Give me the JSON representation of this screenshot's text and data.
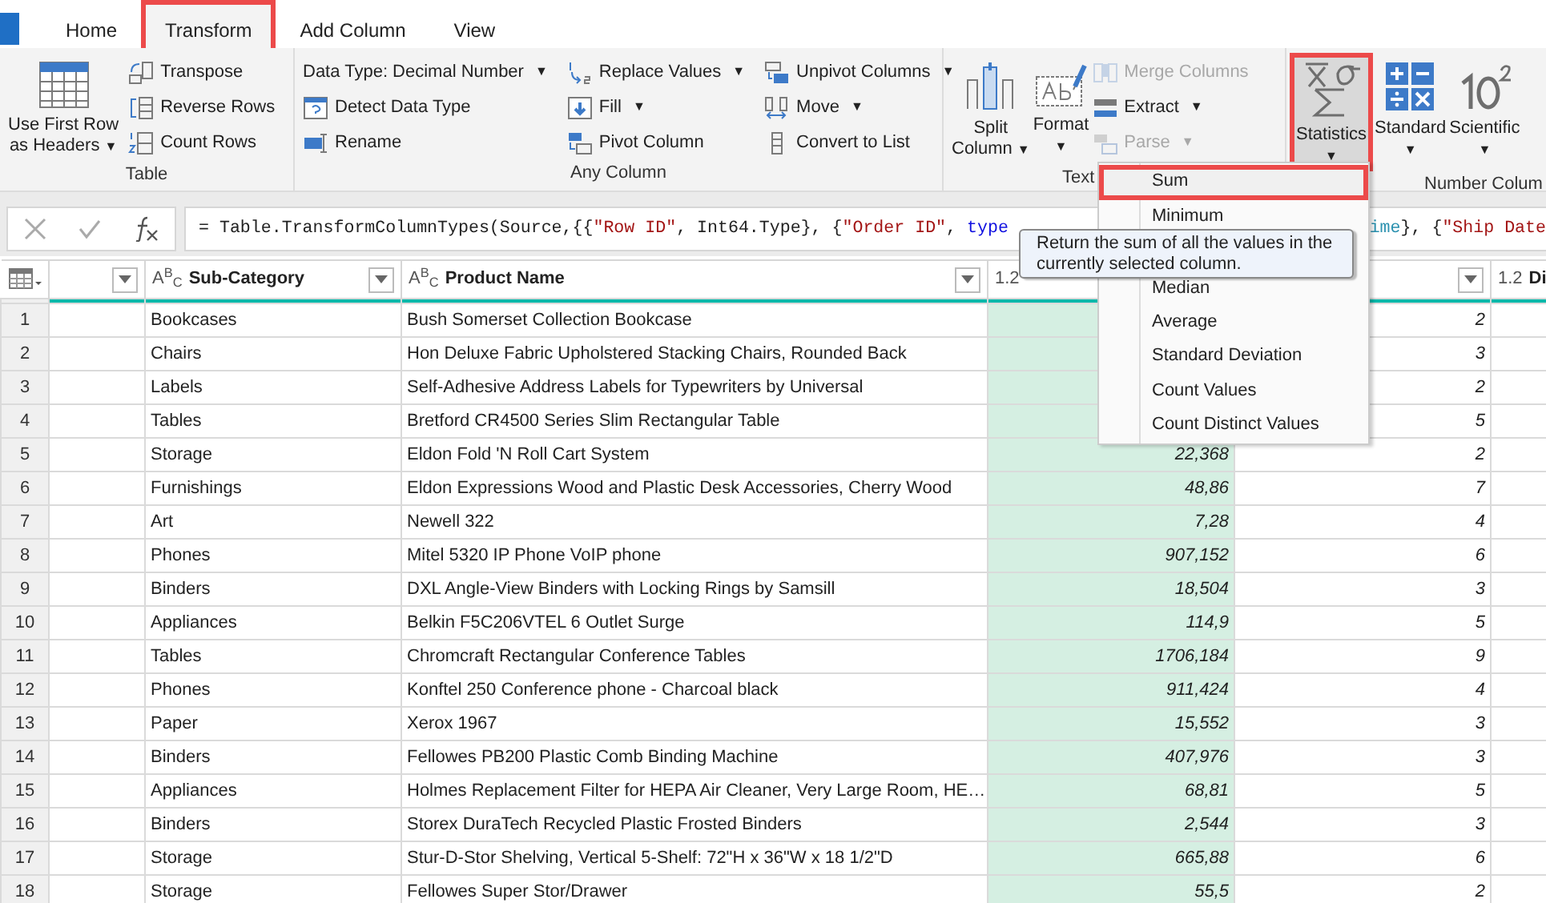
{
  "tabs": [
    {
      "label": "Home",
      "selected": false,
      "annotated": false
    },
    {
      "label": "Transform",
      "selected": true,
      "annotated": true
    },
    {
      "label": "Add Column",
      "selected": false,
      "annotated": false
    },
    {
      "label": "View",
      "selected": false,
      "annotated": false
    }
  ],
  "ribbon": {
    "groups": [
      {
        "label": "Table",
        "items": [
          {
            "kind": "large",
            "lines": [
              "Use First Row",
              "as Headers"
            ],
            "caret": "▼",
            "caret_below": false,
            "pressed": false,
            "annotated": false
          },
          {
            "kind": "stack",
            "items": [
              {
                "label": "Transpose",
                "disabled": false
              },
              {
                "label": "Reverse Rows",
                "disabled": false
              },
              {
                "label": "Count Rows",
                "disabled": false
              }
            ]
          }
        ]
      },
      {
        "label": "Any Column",
        "items": [
          {
            "kind": "stack",
            "items": [
              {
                "label": "Data Type: Decimal Number",
                "caret": "▼",
                "disabled": false
              },
              {
                "label": "Detect Data Type",
                "disabled": false
              },
              {
                "label": "Rename",
                "disabled": false
              }
            ]
          },
          {
            "kind": "stack",
            "items": [
              {
                "label": "Replace Values",
                "caret": "▼",
                "disabled": false
              },
              {
                "label": "Fill",
                "caret": "▼",
                "disabled": false
              },
              {
                "label": "Pivot Column",
                "disabled": false
              }
            ]
          },
          {
            "kind": "stack",
            "items": [
              {
                "label": "Unpivot Columns",
                "caret": "▼",
                "disabled": false
              },
              {
                "label": "Move",
                "caret": "▼",
                "disabled": false
              },
              {
                "label": "Convert to List",
                "disabled": false
              }
            ]
          }
        ]
      },
      {
        "label": "Text",
        "items": [
          {
            "kind": "large",
            "lines": [
              "Split",
              "Column"
            ],
            "caret": "▼",
            "caret_below": false,
            "pressed": false,
            "annotated": false
          },
          {
            "kind": "large",
            "lines": [
              "Format"
            ],
            "caret": "▼",
            "caret_below": true,
            "pressed": false,
            "annotated": false
          },
          {
            "kind": "stack",
            "items": [
              {
                "label": "Merge Columns",
                "disabled": true
              },
              {
                "label": "Extract",
                "caret": "▼",
                "disabled": false
              },
              {
                "label": "Parse",
                "caret": "▼",
                "disabled": true
              }
            ]
          }
        ]
      },
      {
        "label": "Number Colum",
        "items": [
          {
            "kind": "large",
            "lines": [
              "Statistics"
            ],
            "caret": "▼",
            "caret_below": true,
            "pressed": true,
            "annotated": true
          },
          {
            "kind": "large",
            "lines": [
              "Standard"
            ],
            "caret": "▼",
            "caret_below": true,
            "pressed": false,
            "annotated": false
          },
          {
            "kind": "large",
            "lines": [
              "Scientific"
            ],
            "caret": "▼",
            "caret_below": true,
            "pressed": false,
            "annotated": false
          }
        ]
      }
    ]
  },
  "formula_bar": {
    "segments": [
      [
        {
          "t": "= Table.TransformColumnTypes(Source,{{",
          "kind": "plain"
        },
        {
          "t": "\"Row ID\"",
          "kind": "string"
        },
        {
          "t": ", Int64.Type}, {",
          "kind": "plain"
        },
        {
          "t": "\"Order ID\"",
          "kind": "string"
        },
        {
          "t": ", ",
          "kind": "plain"
        },
        {
          "t": "type",
          "kind": "keyword"
        }
      ],
      [
        {
          "t": "ime",
          "kind": "type"
        },
        {
          "t": "}, {",
          "kind": "plain"
        },
        {
          "t": "\"Ship Date",
          "kind": "string"
        }
      ]
    ]
  },
  "table": {
    "columns": [
      {
        "dropdown": true
      },
      {
        "type": "A$^{B}$$_{C}$",
        "label": "Sub-Category",
        "dropdown": true
      },
      {
        "type": "A$^{B}$$_{C}$",
        "label": "Product Name",
        "dropdown": true
      },
      {
        "type": "1.2"
      },
      {
        "dropdown": true
      },
      {
        "type": "1.2",
        "label": "Di"
      }
    ],
    "rows": [
      {
        "n": "1",
        "sub": "Bookcases",
        "product": "Bush Somerset Collection Bookcase",
        "qty": "2"
      },
      {
        "n": "2",
        "sub": "Chairs",
        "product": "Hon Deluxe Fabric Upholstered Stacking Chairs, Rounded Back",
        "qty": "3"
      },
      {
        "n": "3",
        "sub": "Labels",
        "product": "Self-Adhesive Address Labels for Typewriters by Universal",
        "qty": "2"
      },
      {
        "n": "4",
        "sub": "Tables",
        "product": "Bretford CR4500 Series Slim Rectangular Table",
        "qty": "5"
      },
      {
        "n": "5",
        "sub": "Storage",
        "product": "Eldon Fold 'N Roll Cart System",
        "sales": "22,368",
        "qty": "2"
      },
      {
        "n": "6",
        "sub": "Furnishings",
        "product": "Eldon Expressions Wood and Plastic Desk Accessories, Cherry Wood",
        "sales": "48,86",
        "qty": "7"
      },
      {
        "n": "7",
        "sub": "Art",
        "product": "Newell 322",
        "sales": "7,28",
        "qty": "4"
      },
      {
        "n": "8",
        "sub": "Phones",
        "product": "Mitel 5320 IP Phone VoIP phone",
        "sales": "907,152",
        "qty": "6"
      },
      {
        "n": "9",
        "sub": "Binders",
        "product": "DXL Angle-View Binders with Locking Rings by Samsill",
        "sales": "18,504",
        "qty": "3"
      },
      {
        "n": "10",
        "sub": "Appliances",
        "product": "Belkin F5C206VTEL 6 Outlet Surge",
        "sales": "114,9",
        "qty": "5"
      },
      {
        "n": "11",
        "sub": "Tables",
        "product": "Chromcraft Rectangular Conference Tables",
        "sales": "1706,184",
        "qty": "9"
      },
      {
        "n": "12",
        "sub": "Phones",
        "product": "Konftel 250 Conference phone - Charcoal black",
        "sales": "911,424",
        "qty": "4"
      },
      {
        "n": "13",
        "sub": "Paper",
        "product": "Xerox 1967",
        "sales": "15,552",
        "qty": "3"
      },
      {
        "n": "14",
        "sub": "Binders",
        "product": "Fellowes PB200 Plastic Comb Binding Machine",
        "sales": "407,976",
        "qty": "3"
      },
      {
        "n": "15",
        "sub": "Appliances",
        "product": "Holmes Replacement Filter for HEPA Air Cleaner, Very Large Room, HE…",
        "sales": "68,81",
        "qty": "5"
      },
      {
        "n": "16",
        "sub": "Binders",
        "product": "Storex DuraTech Recycled Plastic Frosted Binders",
        "sales": "2,544",
        "qty": "3"
      },
      {
        "n": "17",
        "sub": "Storage",
        "product": "Stur-D-Stor Shelving, Vertical 5-Shelf: 72\"H x 36\"W x 18 1/2\"D",
        "sales": "665,88",
        "qty": "6"
      },
      {
        "n": "18",
        "sub": "Storage",
        "product": "Fellowes Super Stor/Drawer",
        "sales": "55,5",
        "qty": "2"
      }
    ]
  },
  "statistics_menu": {
    "items": [
      {
        "label": "Sum",
        "highlighted": true
      },
      {
        "label": "Minimum",
        "highlighted": false
      },
      {
        "label": "Median",
        "highlighted": false
      },
      {
        "label": "Average",
        "highlighted": false
      },
      {
        "label": "Standard Deviation",
        "highlighted": false
      },
      {
        "label": "Count Values",
        "highlighted": false
      },
      {
        "label": "Count Distinct Values",
        "highlighted": false
      }
    ]
  },
  "tooltip": {
    "text": "Return the sum of all the values in the currently selected column."
  }
}
